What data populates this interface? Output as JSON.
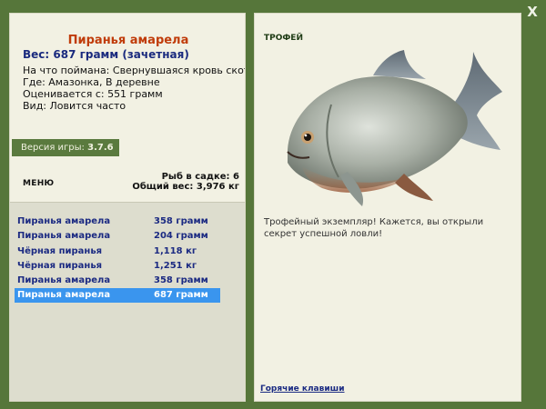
{
  "window": {
    "close_glyph": "X"
  },
  "fish_card": {
    "title": "Пиранья амарела",
    "weight_line": "Вес: 687 грамм (зачетная)",
    "bait_line": "На что поймана: Свернувшаяся кровь скота",
    "location_line": "Где: Амазонка, В деревне",
    "value_line": "Оценивается с: 551 грамм",
    "rarity_line": "Вид: Ловится часто"
  },
  "version": {
    "label": "Версия игры:",
    "value": "3.7.6"
  },
  "menu": {
    "label": "МЕНЮ"
  },
  "cage": {
    "count_line": "Рыб в садке: 6",
    "total_line": "Общий вес: 3,976 кг"
  },
  "catch_list": [
    {
      "name": "Пиранья амарела",
      "weight": "358 грамм",
      "selected": false
    },
    {
      "name": "Пиранья амарела",
      "weight": "204 грамм",
      "selected": false
    },
    {
      "name": "Чёрная пиранья",
      "weight": "1,118 кг",
      "selected": false
    },
    {
      "name": "Чёрная пиранья",
      "weight": "1,251 кг",
      "selected": false
    },
    {
      "name": "Пиранья амарела",
      "weight": "358 грамм",
      "selected": false
    },
    {
      "name": "Пиранья амарела",
      "weight": "687 грамм",
      "selected": true
    }
  ],
  "trophy": {
    "heading": "ТРОФЕЙ",
    "description": "Трофейный экземпляр! Кажется, вы открыли секрет успешной ловли!"
  },
  "hotkeys": {
    "label": "Горячие клавиши"
  }
}
